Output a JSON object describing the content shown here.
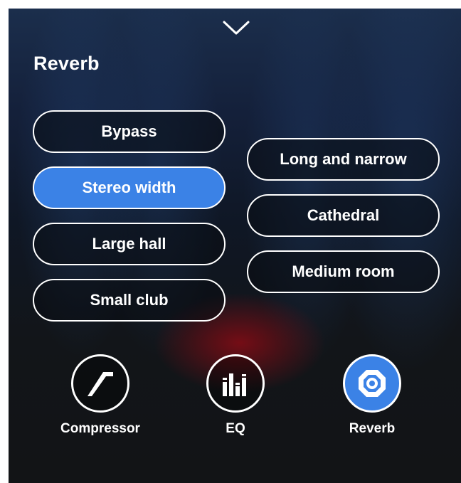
{
  "header": {
    "title": "Reverb",
    "collapse_icon": "chevron-down-icon"
  },
  "presets": {
    "left": [
      {
        "label": "Bypass",
        "selected": false
      },
      {
        "label": "Stereo width",
        "selected": true
      },
      {
        "label": "Large hall",
        "selected": false
      },
      {
        "label": "Small club",
        "selected": false
      }
    ],
    "right": [
      {
        "label": "Long and narrow",
        "selected": false
      },
      {
        "label": "Cathedral",
        "selected": false
      },
      {
        "label": "Medium room",
        "selected": false
      }
    ]
  },
  "tabs": [
    {
      "label": "Compressor",
      "icon": "compressor-icon",
      "active": false
    },
    {
      "label": "EQ",
      "icon": "eq-icon",
      "active": false
    },
    {
      "label": "Reverb",
      "icon": "reverb-icon",
      "active": true
    }
  ],
  "colors": {
    "accent": "#3b82e6",
    "text": "#ffffff",
    "background": "#121416"
  }
}
